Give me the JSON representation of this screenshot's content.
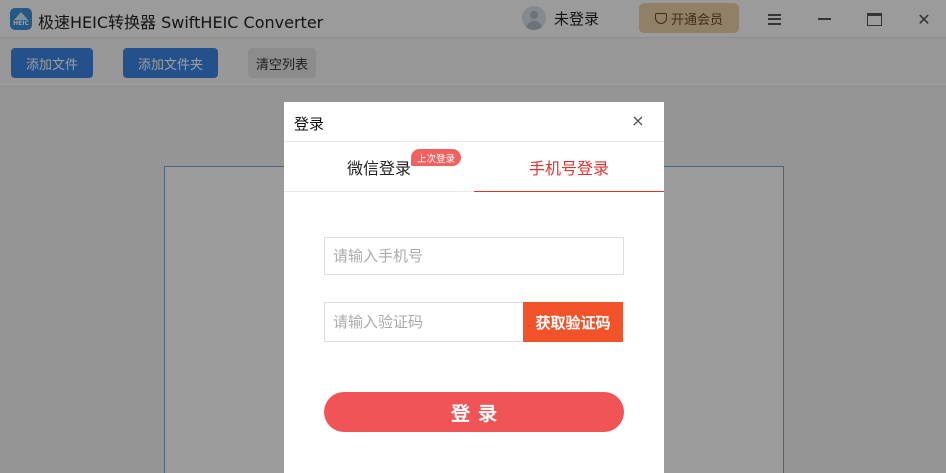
{
  "app": {
    "logo_text": "HEIC",
    "title": "极速HEIC转换器 SwiftHEIC Converter",
    "user_label": "未登录",
    "vip_label": "开通会员"
  },
  "toolbar": {
    "add_file": "添加文件",
    "add_folder": "添加文件夹",
    "clear_list": "清空列表"
  },
  "dialog": {
    "title": "登录",
    "close_icon": "×",
    "tabs": [
      {
        "label": "微信登录",
        "badge": "上次登录"
      },
      {
        "label": "手机号登录",
        "active": true
      }
    ],
    "phone_placeholder": "请输入手机号",
    "code_placeholder": "请输入验证码",
    "get_code_label": "获取验证码",
    "login_label": "登录"
  },
  "colors": {
    "accent_red": "#e0322e",
    "button_orange": "#f0522a",
    "login_button": "#f05456",
    "toolbar_blue": "#3b82e0",
    "vip_gold": "#e7cfa6"
  }
}
